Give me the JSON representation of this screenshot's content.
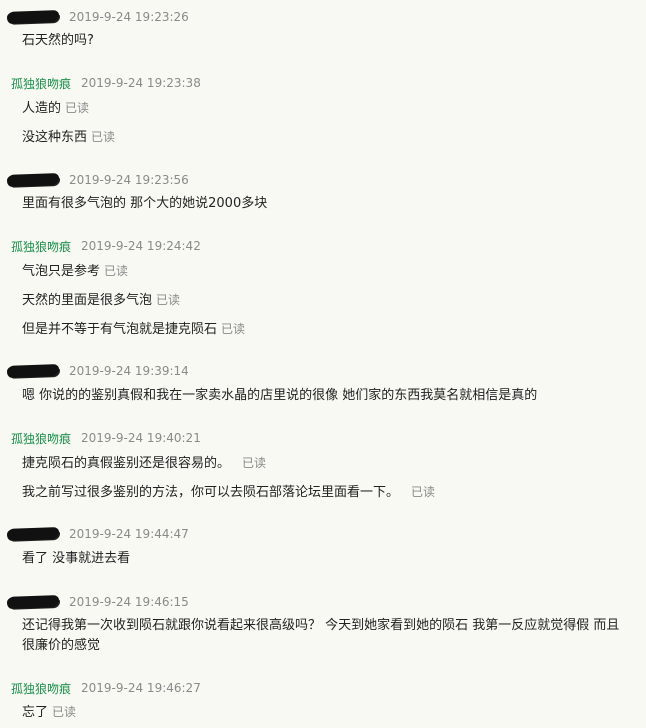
{
  "sender_name": "孤独狼吻痕",
  "read_label": "已读",
  "messages": [
    {
      "time": "2019-9-24 19:23:26",
      "lines": [
        "石天然的吗?"
      ]
    },
    {
      "time": "2019-9-24 19:23:38",
      "lines": [
        "人造的",
        "没这种东西"
      ]
    },
    {
      "time": "2019-9-24 19:23:56",
      "lines": [
        "里面有很多气泡的 那个大的她说2000多块"
      ]
    },
    {
      "time": "2019-9-24 19:24:42",
      "lines": [
        "气泡只是参考",
        "天然的里面是很多气泡",
        "但是并不等于有气泡就是捷克陨石"
      ]
    },
    {
      "time": "2019-9-24 19:39:14",
      "lines": [
        "嗯 你说的的鉴别真假和我在一家卖水晶的店里说的很像 她们家的东西我莫名就相信是真的"
      ]
    },
    {
      "time": "2019-9-24 19:40:21",
      "lines": [
        "捷克陨石的真假鉴别还是很容易的。",
        "我之前写过很多鉴别的方法，你可以去陨石部落论坛里面看一下。"
      ]
    },
    {
      "time": "2019-9-24 19:44:47",
      "lines": [
        "看了 没事就进去看"
      ]
    },
    {
      "time": "2019-9-24 19:46:15",
      "lines": [
        "还记得我第一次收到陨石就跟你说看起来很高级吗？  今天到她家看到她的陨石 我第一反应就觉得假 而且很廉价的感觉"
      ]
    },
    {
      "time": "2019-9-24 19:46:27",
      "lines": [
        "忘了"
      ]
    }
  ]
}
